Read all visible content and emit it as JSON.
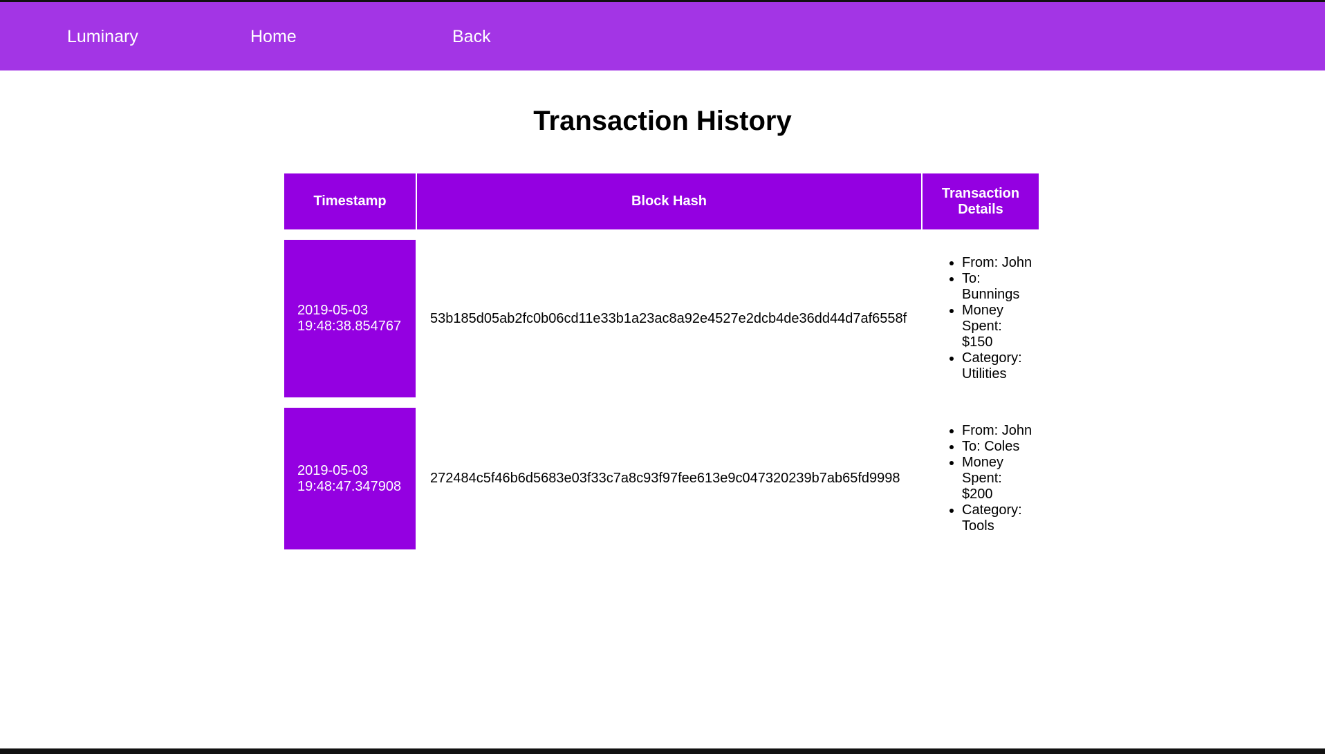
{
  "navbar": {
    "brand": "Luminary",
    "home": "Home",
    "back": "Back"
  },
  "page": {
    "title": "Transaction History"
  },
  "table": {
    "headers": {
      "timestamp": "Timestamp",
      "block_hash": "Block Hash",
      "details": "Transaction Details"
    },
    "rows": [
      {
        "timestamp": "2019-05-03 19:48:38.854767",
        "block_hash": "53b185d05ab2fc0b06cd11e33b1a23ac8a92e4527e2dcb4de36dd44d7af6558f",
        "details": {
          "from": "From: John",
          "to": "To: Bunnings",
          "money": "Money Spent: $150",
          "category": "Category: Utilities"
        }
      },
      {
        "timestamp": "2019-05-03 19:48:47.347908",
        "block_hash": "272484c5f46b6d5683e03f33c7a8c93f97fee613e9c047320239b7ab65fd9998",
        "details": {
          "from": "From: John",
          "to": "To: Coles",
          "money": "Money Spent: $200",
          "category": "Category: Tools"
        }
      }
    ]
  },
  "colors": {
    "navbar_bg": "#a335e5",
    "accent": "#9400e1",
    "text_on_accent": "#ffffff"
  }
}
